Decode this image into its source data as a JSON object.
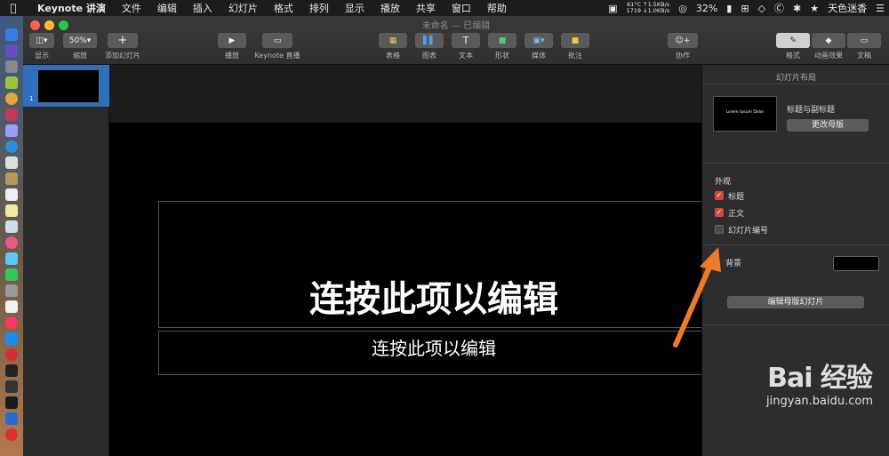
{
  "menubar": {
    "app_name": "Keynote 讲演",
    "items": [
      "文件",
      "编辑",
      "插入",
      "幻灯片",
      "格式",
      "排列",
      "显示",
      "播放",
      "共享",
      "窗口",
      "帮助"
    ],
    "temp": "61°C",
    "net_up": "↑1.5KB/s",
    "fan": "1719",
    "net_down": "↓1.0KB/s",
    "battery": "32%",
    "user": "天色迷香"
  },
  "window": {
    "title": "未命名 — 已编辑"
  },
  "toolbar": {
    "view_label": "显示",
    "zoom_value": "50%",
    "zoom_label": "缩放",
    "add_slide_label": "添加幻灯片",
    "play_label": "播放",
    "keynote_live_label": "Keynote 直播",
    "table_label": "表格",
    "chart_label": "图表",
    "text_label": "文本",
    "shape_label": "形状",
    "media_label": "媒体",
    "comment_label": "批注",
    "collaborate_label": "协作",
    "format_label": "格式",
    "animate_label": "动画效果",
    "document_label": "文稿"
  },
  "navigator": {
    "slide_number": "1"
  },
  "slide": {
    "title": "连按此项以编辑",
    "subtitle": "连按此项以编辑"
  },
  "inspector": {
    "title": "幻灯片布局",
    "master_name": "标题与副标题",
    "thumb_title": "Lorem Ipsum Dolor",
    "change_master_button": "更改母版",
    "appearance_heading": "外观",
    "options": [
      {
        "label": "标题",
        "checked": true
      },
      {
        "label": "正文",
        "checked": true
      },
      {
        "label": "幻灯片编号",
        "checked": false
      }
    ],
    "background_label": "背景",
    "background_color": "#000000",
    "edit_master_button": "编辑母版幻灯片"
  },
  "overlay": {
    "arrow_color": "#f07a28",
    "watermark_logo": "Bai 经验",
    "watermark_url": "jingyan.baidu.com"
  }
}
